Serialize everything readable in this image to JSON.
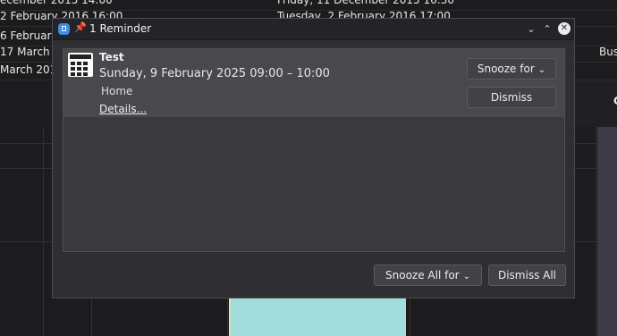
{
  "background_list": {
    "rows": [
      {
        "start": "ecember 2015 14:00",
        "end": "Friday, 11 December 2015 16:30",
        "extra": ""
      },
      {
        "start": "2 February 2016 16:00",
        "end": "Tuesday, 2 February 2016 17:00",
        "extra": ""
      },
      {
        "start": "6 February",
        "end": "",
        "extra": ""
      },
      {
        "start": "17 March 2",
        "end": "",
        "extra": "Bus"
      },
      {
        "start": "March 2016",
        "end": "",
        "extra": ""
      }
    ],
    "side_letter": "C"
  },
  "window": {
    "title": "1 Reminder",
    "pin_icon": "📌",
    "minimize_symbol": "⌄",
    "maximize_symbol": "⌃",
    "close_symbol": "✕"
  },
  "reminder": {
    "title": "Test",
    "datetime": "Sunday, 9 February 2025 09:00 – 10:00",
    "location": "Home",
    "details_link": "Details...",
    "snooze_label": "Snooze for",
    "dismiss_label": "Dismiss"
  },
  "footer": {
    "snooze_all_label": "Snooze All for",
    "dismiss_all_label": "Dismiss All"
  },
  "colors": {
    "app_icon": "#3a8ee6",
    "event_block": "#a3dcdc"
  }
}
